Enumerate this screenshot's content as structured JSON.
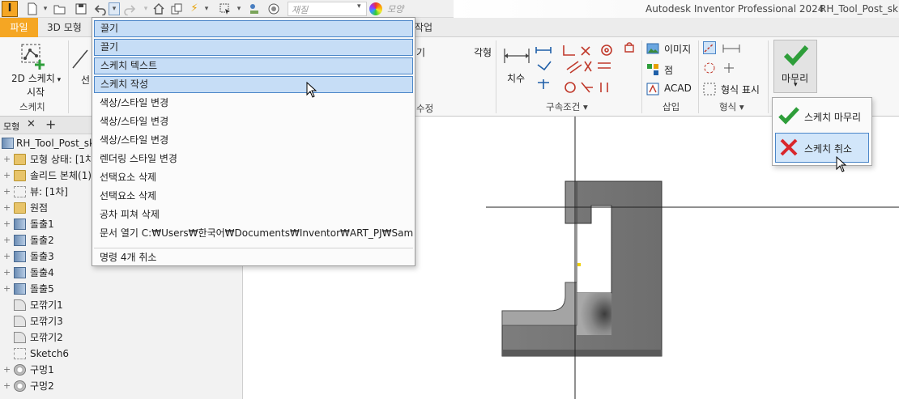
{
  "app": {
    "logo": "I",
    "title": "Autodesk Inventor Professional 2024",
    "document": "RH_Tool_Post_sk"
  },
  "qat": {
    "material_placeholder": "재질",
    "appearance_placeholder": "모양"
  },
  "tabs": {
    "file": "파일",
    "model": "3D 모형",
    "hidden_fragment": "작업"
  },
  "ribbon": {
    "sketch_panel": {
      "button": "2D 스케치\n시작",
      "button_line1": "2D 스케치",
      "button_line2": "시작",
      "label": "스케치"
    },
    "create_fragment": "선",
    "modify_fragments": {
      "a": "기",
      "b": "각형",
      "c": "수정"
    },
    "dimension": "치수",
    "constraints_label": "구속조건 ▾",
    "insert": {
      "image": "이미지",
      "point": "점",
      "acad": "ACAD",
      "label": "삽입"
    },
    "format": {
      "show_format": "형식 표시",
      "label": "형식 ▾"
    },
    "exit": {
      "label": "마무리",
      "arrow": "▾"
    }
  },
  "browser": {
    "tab": "모형",
    "add": "+",
    "close": "✕",
    "items": [
      {
        "icon": "part-icon",
        "label": "RH_Tool_Post_sk",
        "expander": ""
      },
      {
        "icon": "folder-icon",
        "label": "모형 상태: [1차",
        "expander": "+"
      },
      {
        "icon": "folder-icon",
        "label": "솔리드 본체(1)",
        "expander": "+"
      },
      {
        "icon": "view-icon",
        "label": "뷰: [1차]",
        "expander": "+"
      },
      {
        "icon": "folder-icon",
        "label": "원점",
        "expander": "+"
      },
      {
        "icon": "extrude-icon",
        "label": "돌출1",
        "expander": "+"
      },
      {
        "icon": "extrude-icon",
        "label": "돌출2",
        "expander": "+"
      },
      {
        "icon": "extrude-icon",
        "label": "돌출3",
        "expander": "+"
      },
      {
        "icon": "extrude-icon",
        "label": "돌출4",
        "expander": "+"
      },
      {
        "icon": "extrude-icon",
        "label": "돌출5",
        "expander": "+"
      },
      {
        "icon": "fillet-icon",
        "label": "모깎기1",
        "expander": ""
      },
      {
        "icon": "fillet-icon",
        "label": "모깎기3",
        "expander": ""
      },
      {
        "icon": "fillet-icon",
        "label": "모깎기2",
        "expander": ""
      },
      {
        "icon": "sketch-icon",
        "label": "Sketch6",
        "expander": ""
      },
      {
        "icon": "hole-icon",
        "label": "구멍1",
        "expander": "+"
      },
      {
        "icon": "hole-icon",
        "label": "구멍2",
        "expander": "+"
      }
    ]
  },
  "undo_menu": {
    "items": [
      {
        "label": "끌기",
        "selected": true
      },
      {
        "label": "끌기",
        "selected": true
      },
      {
        "label": "스케치 텍스트",
        "selected": true
      },
      {
        "label": "스케치 작성",
        "selected": true
      },
      {
        "label": "색상/스타일 변경",
        "selected": false
      },
      {
        "label": "색상/스타일 변경",
        "selected": false
      },
      {
        "label": "색상/스타일 변경",
        "selected": false
      },
      {
        "label": "렌더링 스타일 변경",
        "selected": false
      },
      {
        "label": "선택요소 삭제",
        "selected": false
      },
      {
        "label": "선택요소 삭제",
        "selected": false
      },
      {
        "label": "공차 피쳐 삭제",
        "selected": false
      },
      {
        "label": "문서 열기 C:₩Users₩한국어₩Documents₩Inventor₩ART_PJ₩Sample_file",
        "selected": false
      }
    ],
    "footer": "명령 4개 취소"
  },
  "finish_menu": {
    "finish_sketch": "스케치 마무리",
    "cancel_sketch": "스케치 취소"
  },
  "colors": {
    "accent": "#f5a623",
    "selection": "#c6ddf6",
    "selection_border": "#4b86c8",
    "check_green": "#2e9e3a",
    "cancel_red": "#d9262c"
  }
}
